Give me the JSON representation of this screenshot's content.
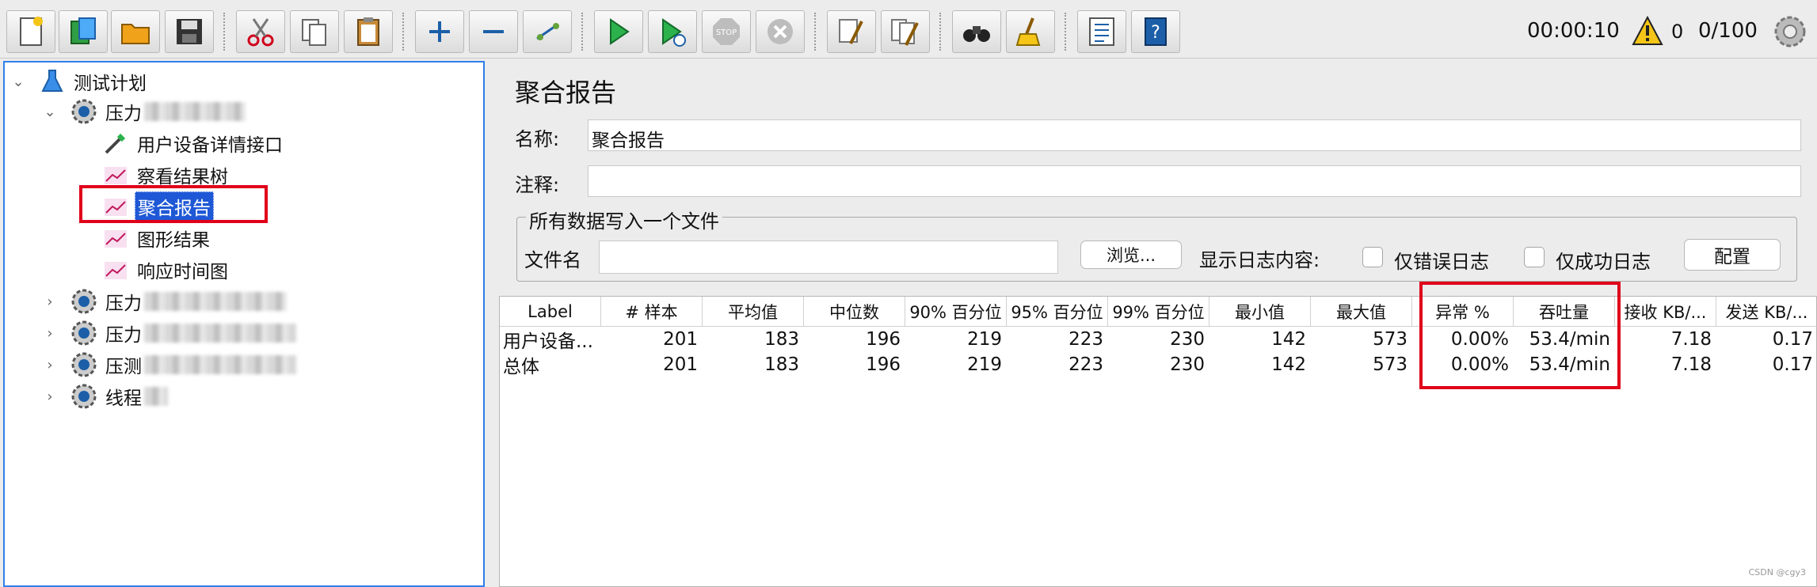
{
  "status": {
    "elapsed_time": "00:00:10",
    "warning_count": "0",
    "active_threads": "0/100"
  },
  "tree": {
    "root_label": "测试计划",
    "group1_label": "压力",
    "children": [
      "用户设备详情接口",
      "察看结果树",
      "聚合报告",
      "图形结果",
      "响应时间图"
    ],
    "other_groups": [
      "压力",
      "压力",
      "压测",
      "线程"
    ]
  },
  "panel": {
    "title": "聚合报告",
    "name_label": "名称:",
    "name_value": "聚合报告",
    "comment_label": "注释:",
    "comment_value": "",
    "file_group_title": "所有数据写入一个文件",
    "filename_label": "文件名",
    "browse_button": "浏览...",
    "log_display_label": "显示日志内容:",
    "errors_only_label": "仅错误日志",
    "success_only_label": "仅成功日志",
    "configure_button": "配置"
  },
  "table": {
    "headers": [
      "Label",
      "# 样本",
      "平均值",
      "中位数",
      "90% 百分位",
      "95% 百分位",
      "99% 百分位",
      "最小值",
      "最大值",
      "异常 %",
      "吞吐量",
      "接收 KB/...",
      "发送 KB/..."
    ],
    "rows": [
      [
        "用户设备...",
        "201",
        "183",
        "196",
        "219",
        "223",
        "230",
        "142",
        "573",
        "0.00%",
        "53.4/min",
        "7.18",
        "0.17"
      ],
      [
        "总体",
        "201",
        "183",
        "196",
        "219",
        "223",
        "230",
        "142",
        "573",
        "0.00%",
        "53.4/min",
        "7.18",
        "0.17"
      ]
    ]
  },
  "watermark": "CSDN @cgy3"
}
